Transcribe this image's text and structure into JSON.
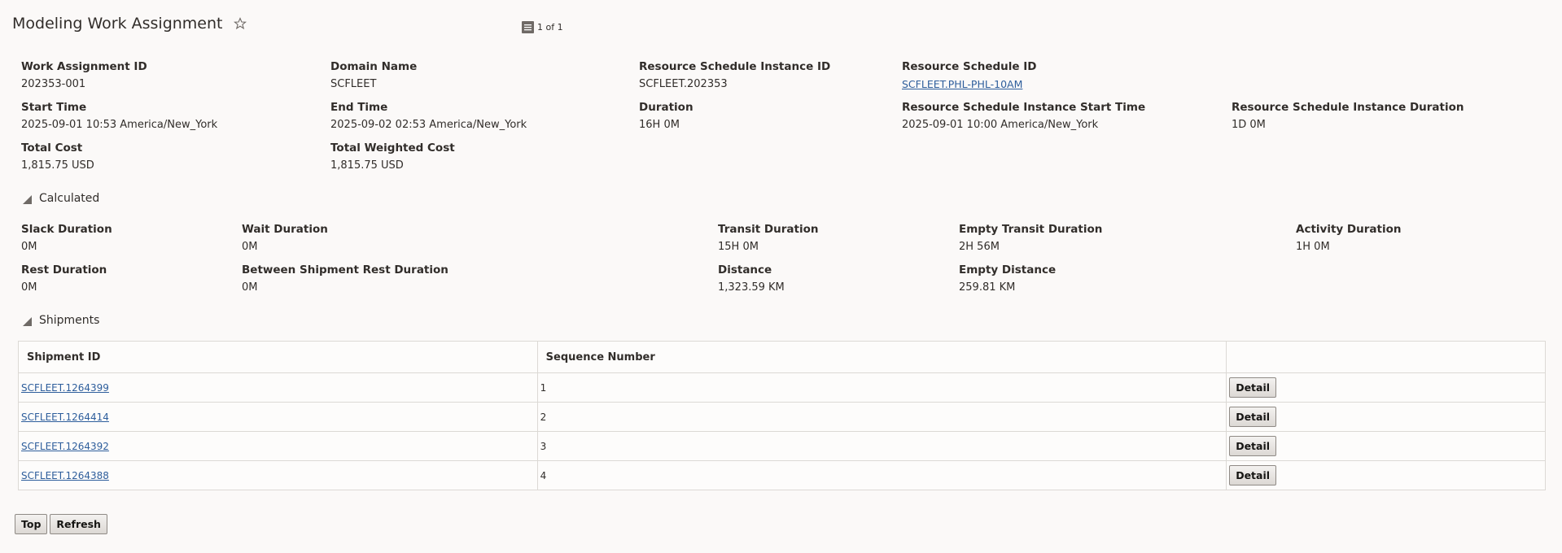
{
  "header": {
    "title": "Modeling Work Assignment",
    "pager_text": "1 of 1"
  },
  "summary": {
    "work_assignment_id": {
      "label": "Work Assignment ID",
      "value": "202353-001"
    },
    "domain_name": {
      "label": "Domain Name",
      "value": "SCFLEET"
    },
    "resource_schedule_instance_id": {
      "label": "Resource Schedule Instance ID",
      "value": "SCFLEET.202353"
    },
    "resource_schedule_id": {
      "label": "Resource Schedule ID",
      "value": "SCFLEET.PHL-PHL-10AM"
    },
    "start_time": {
      "label": "Start Time",
      "value": "2025-09-01 10:53 America/New_York"
    },
    "end_time": {
      "label": "End Time",
      "value": "2025-09-02 02:53 America/New_York"
    },
    "duration": {
      "label": "Duration",
      "value": "16H 0M"
    },
    "rsi_start_time": {
      "label": "Resource Schedule Instance Start Time",
      "value": "2025-09-01 10:00 America/New_York"
    },
    "rsi_duration": {
      "label": "Resource Schedule Instance Duration",
      "value": "1D 0M"
    },
    "total_cost": {
      "label": "Total Cost",
      "value": "1,815.75 USD"
    },
    "total_weighted_cost": {
      "label": "Total Weighted Cost",
      "value": "1,815.75 USD"
    }
  },
  "calculated": {
    "section_title": "Calculated",
    "slack_duration": {
      "label": "Slack Duration",
      "value": "0M"
    },
    "wait_duration": {
      "label": "Wait Duration",
      "value": "0M"
    },
    "transit_duration": {
      "label": "Transit Duration",
      "value": "15H 0M"
    },
    "empty_transit_duration": {
      "label": "Empty Transit Duration",
      "value": "2H 56M"
    },
    "activity_duration": {
      "label": "Activity Duration",
      "value": "1H 0M"
    },
    "rest_duration": {
      "label": "Rest Duration",
      "value": "0M"
    },
    "between_shipment_rest_duration": {
      "label": "Between Shipment Rest Duration",
      "value": "0M"
    },
    "distance": {
      "label": "Distance",
      "value": "1,323.59 KM"
    },
    "empty_distance": {
      "label": "Empty Distance",
      "value": "259.81 KM"
    }
  },
  "shipments": {
    "section_title": "Shipments",
    "columns": [
      "Shipment ID",
      "Sequence Number",
      ""
    ],
    "detail_label": "Detail",
    "rows": [
      {
        "shipment_id": "SCFLEET.1264399",
        "sequence": "1"
      },
      {
        "shipment_id": "SCFLEET.1264414",
        "sequence": "2"
      },
      {
        "shipment_id": "SCFLEET.1264392",
        "sequence": "3"
      },
      {
        "shipment_id": "SCFLEET.1264388",
        "sequence": "4"
      }
    ]
  },
  "footer": {
    "top_label": "Top",
    "refresh_label": "Refresh"
  },
  "colors": {
    "background": "#fbf9f8",
    "link": "#2e5e9c",
    "text": "#312d2a",
    "border": "#dcd9d5"
  },
  "icons": {
    "favorite": "star-outline-icon",
    "pager": "list-icon",
    "section_toggle": "triangle-collapse-icon"
  }
}
